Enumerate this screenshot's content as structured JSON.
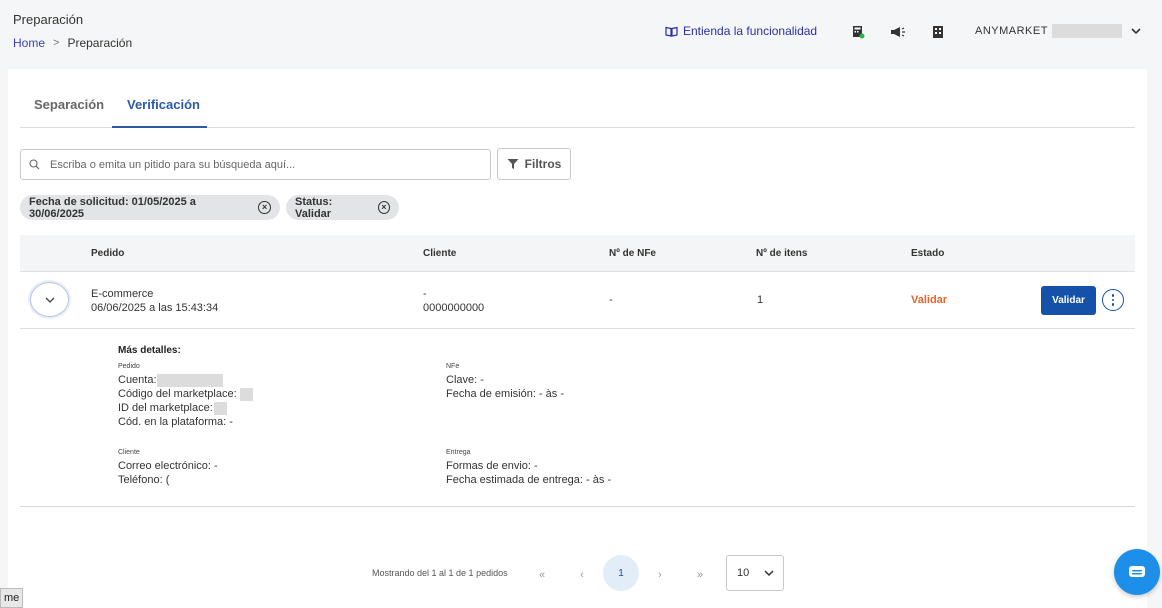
{
  "header": {
    "title": "Preparación",
    "breadcrumb": {
      "home": "Home",
      "separator": ">",
      "current": "Preparación"
    },
    "help_link": "Entienda la funcionalidad",
    "account_name": "ANYMARKET"
  },
  "tabs": [
    {
      "label": "Separación",
      "active": false
    },
    {
      "label": "Verificación",
      "active": true
    }
  ],
  "search": {
    "placeholder": "Escriba o emita un pitido para su búsqueda aquí..."
  },
  "filters_button": "Filtros",
  "chips": [
    {
      "label": "Fecha de solicitud: 01/05/2025 a 30/06/2025"
    },
    {
      "label": "Status: Validar"
    }
  ],
  "table": {
    "columns": [
      "Pedido",
      "Cliente",
      "Nº de NFe",
      "Nº de itens",
      "Estado"
    ],
    "rows": [
      {
        "pedido_channel": "E-commerce",
        "pedido_date": "06/06/2025 a las 15:43:34",
        "cliente_name": "-",
        "cliente_doc": "0000000000",
        "nfe": "-",
        "items": "1",
        "estado": "Validar",
        "action": "Validar"
      }
    ]
  },
  "details": {
    "heading": "Más detalles:",
    "pedido": {
      "label": "Pedido",
      "cuenta": "Cuenta:",
      "codigo": "Código del marketplace:",
      "id": "ID del marketplace:",
      "cod_plataforma": "Cód. en la plataforma: -"
    },
    "nfe": {
      "label": "NFe",
      "clave": "Clave: -",
      "fecha": "Fecha de emisión: - às -"
    },
    "cliente": {
      "label": "Cliente",
      "correo": "Correo electrónico: -",
      "telefono": "Teléfono: ("
    },
    "entrega": {
      "label": "Entrega",
      "formas": "Formas de envio: -",
      "fecha": "Fecha estimada de entrega: - às -"
    }
  },
  "pagination": {
    "summary": "Mostrando del 1 al 1 de 1 pedidos",
    "current_page": "1",
    "page_size": "10"
  },
  "bottom_tag": "me",
  "colors": {
    "primary": "#1352a8",
    "link": "#2a2fa8",
    "status_validar": "#e8632a",
    "chat": "#1d8fe8"
  }
}
